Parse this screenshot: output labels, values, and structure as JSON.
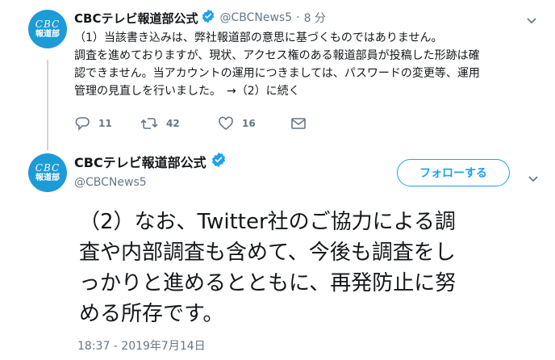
{
  "colors": {
    "brand": "#1d9bd7",
    "accent": "#1da1f2",
    "muted": "#657786",
    "line": "#ccd6dd"
  },
  "avatar": {
    "logo": "CBC",
    "sub": "報道部"
  },
  "tweet1": {
    "name": "CBCテレビ報道部公式",
    "handle": "@CBCNews5",
    "sep": "·",
    "time": "8 分",
    "lines": [
      "（1）当該書き込みは、弊社報道部の意思に基づくものではありません。",
      "調査を進めておりますが、現状、アクセス権のある報道部員が投稿した形跡は確",
      "認できません。当アカウントの運用につきましては、パスワードの変更等、運用",
      "管理の見直しを行いました。　→（2）に続く"
    ],
    "actions": {
      "reply_count": "11",
      "retweet_count": "42",
      "like_count": "16"
    },
    "icons": {
      "reply": "reply-icon",
      "retweet": "retweet-icon",
      "like": "heart-icon",
      "dm": "mail-icon",
      "menu": "chevron-down-icon"
    }
  },
  "tweet2": {
    "name": "CBCテレビ報道部公式",
    "handle": "@CBCNews5",
    "follow_label": "フォローする",
    "lines": [
      "（2）なお、Twitter社のご協力による調",
      "査や内部調査も含めて、今後も調査をし",
      "っかりと進めるとともに、再発防止に努",
      "める所存です。"
    ],
    "timestamp": "18:37 - 2019年7月14日"
  }
}
